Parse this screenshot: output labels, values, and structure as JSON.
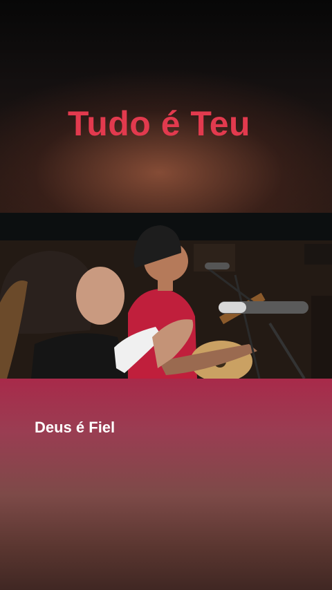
{
  "title": "Tudo é Teu",
  "subtitle": "Deus é Fiel",
  "colors": {
    "title": "#e23a4e",
    "subtitle": "#ffffff"
  }
}
